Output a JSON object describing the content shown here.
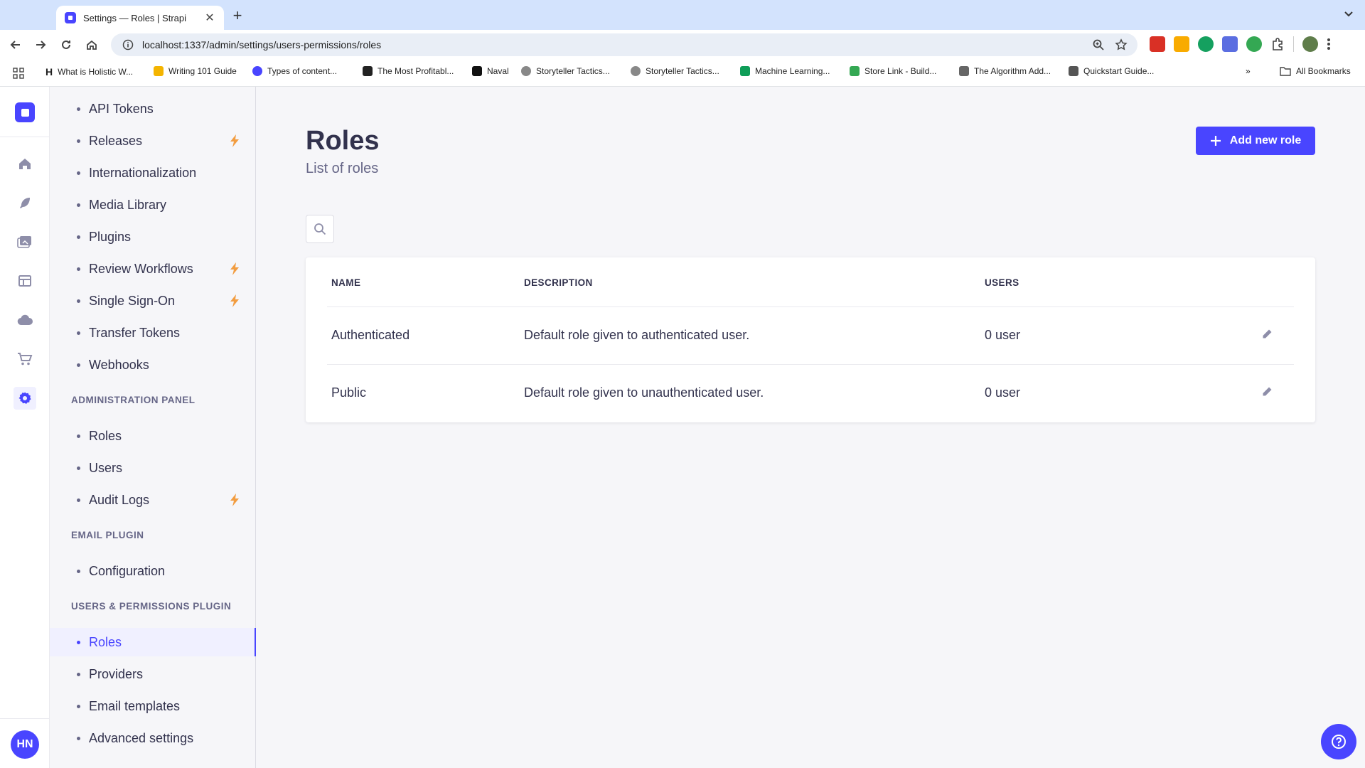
{
  "browser": {
    "tab_title": "Settings — Roles | Strapi",
    "url": "localhost:1337/admin/settings/users-permissions/roles",
    "bookmarks": [
      "What is Holistic W...",
      "Writing 101 Guide",
      "Types of content...",
      "The Most Profitabl...",
      "Naval",
      "Storyteller Tactics...",
      "Storyteller Tactics...",
      "Machine Learning...",
      "Store Link - Build...",
      "The Algorithm Add...",
      "Quickstart Guide..."
    ],
    "all_bookmarks": "All Bookmarks"
  },
  "rail": {
    "avatar_initials": "HN",
    "brand_color": "#4945ff"
  },
  "subnav": {
    "global_items": [
      {
        "label": "API Tokens",
        "bolt": false
      },
      {
        "label": "Releases",
        "bolt": true
      },
      {
        "label": "Internationalization",
        "bolt": false
      },
      {
        "label": "Media Library",
        "bolt": false
      },
      {
        "label": "Plugins",
        "bolt": false
      },
      {
        "label": "Review Workflows",
        "bolt": true
      },
      {
        "label": "Single Sign-On",
        "bolt": true
      },
      {
        "label": "Transfer Tokens",
        "bolt": false
      },
      {
        "label": "Webhooks",
        "bolt": false
      }
    ],
    "admin_section": "ADMINISTRATION PANEL",
    "admin_items": [
      {
        "label": "Roles",
        "bolt": false
      },
      {
        "label": "Users",
        "bolt": false
      },
      {
        "label": "Audit Logs",
        "bolt": true
      }
    ],
    "email_section": "EMAIL PLUGIN",
    "email_items": [
      {
        "label": "Configuration"
      }
    ],
    "up_section": "USERS & PERMISSIONS PLUGIN",
    "up_items": [
      {
        "label": "Roles",
        "active": true
      },
      {
        "label": "Providers",
        "active": false
      },
      {
        "label": "Email templates",
        "active": false
      },
      {
        "label": "Advanced settings",
        "active": false
      }
    ]
  },
  "main": {
    "title": "Roles",
    "subtitle": "List of roles",
    "add_button": "Add new role",
    "table": {
      "headers": [
        "NAME",
        "DESCRIPTION",
        "USERS"
      ],
      "rows": [
        {
          "name": "Authenticated",
          "description": "Default role given to authenticated user.",
          "users": "0 user"
        },
        {
          "name": "Public",
          "description": "Default role given to unauthenticated user.",
          "users": "0 user"
        }
      ]
    }
  }
}
